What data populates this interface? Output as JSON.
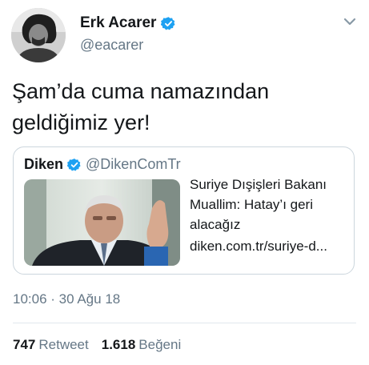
{
  "author": {
    "name": "Erk Acarer",
    "handle": "@eacarer",
    "verified_icon": "verified-badge-icon"
  },
  "tweet": {
    "text_line1": "Şam’da cuma namazından",
    "text_line2": "geldiğimiz yer!"
  },
  "card": {
    "source_name": "Diken",
    "source_handle": "@DikenComTr",
    "title": "Suriye Dışişleri Bakanı Muallim: Hatay’ı geri alacağız",
    "link": "diken.com.tr/suriye-d..."
  },
  "meta": {
    "timestamp": "10:06 · 30 Ağu 18"
  },
  "stats": {
    "retweets_count": "747",
    "retweets_label": "Retweet",
    "likes_count": "1.618",
    "likes_label": "Beğeni"
  },
  "colors": {
    "verified_blue": "#1da1f2",
    "secondary_text": "#657786",
    "border": "#ccd6dd"
  }
}
